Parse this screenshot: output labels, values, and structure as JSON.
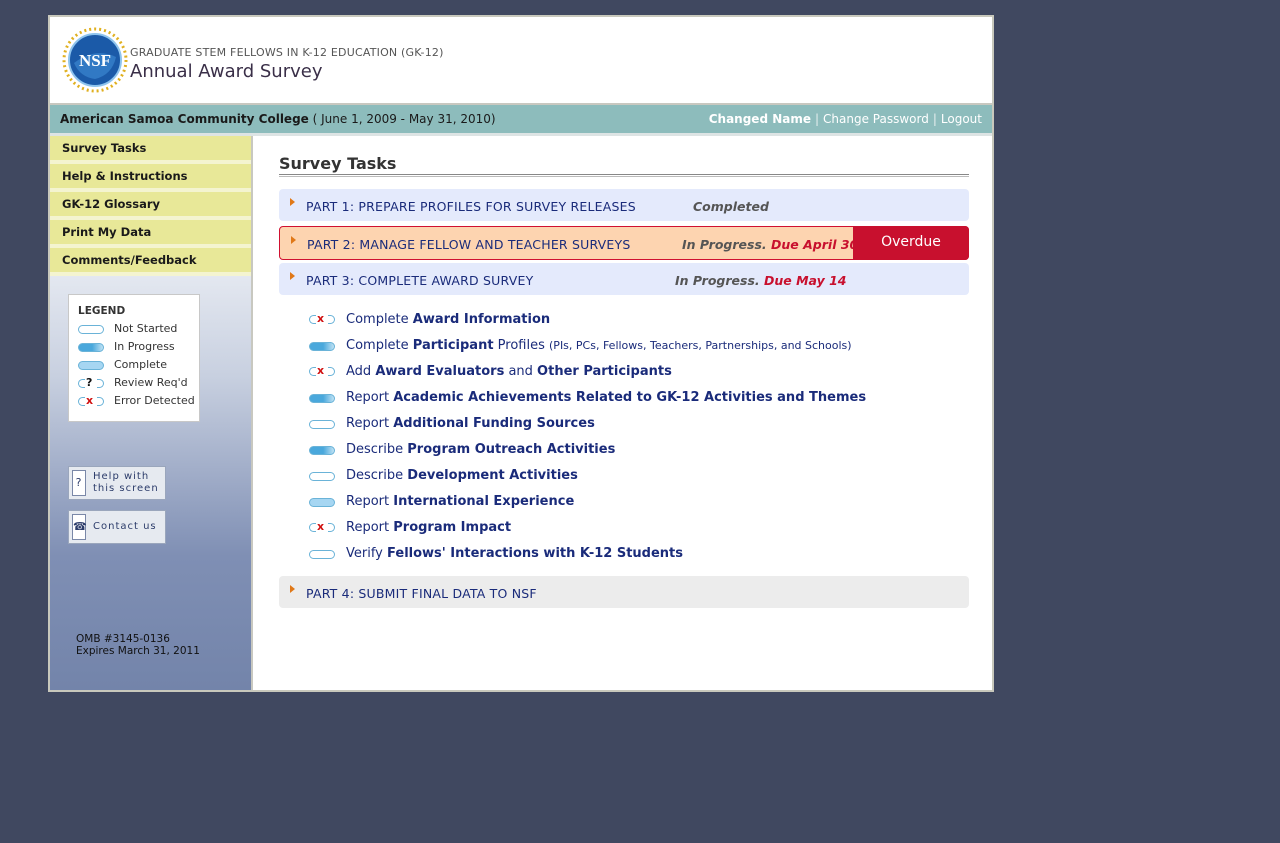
{
  "header": {
    "logo_text": "NSF",
    "program": "GRADUATE STEM FELLOWS IN K-12 EDUCATION (GK-12)",
    "title": "Annual Award Survey"
  },
  "infobar": {
    "organization": "American Samoa Community College",
    "period": "( June 1, 2009 - May 31, 2010)",
    "user": "Changed Name",
    "change_password": "Change Password",
    "logout": "Logout",
    "separator": "|"
  },
  "sidebar": {
    "items": [
      {
        "label": "Survey Tasks"
      },
      {
        "label": "Help & Instructions"
      },
      {
        "label": "GK-12 Glossary"
      },
      {
        "label": "Print My Data"
      },
      {
        "label": "Comments/Feedback"
      }
    ],
    "legend": {
      "title": "LEGEND",
      "items": [
        {
          "label": "Not Started"
        },
        {
          "label": "In Progress"
        },
        {
          "label": "Complete"
        },
        {
          "label": "Review Req'd",
          "mark": "?"
        },
        {
          "label": "Error Detected",
          "mark": "x"
        }
      ]
    },
    "help_button": {
      "line1": "Help with",
      "line2": "this screen",
      "icon": "?"
    },
    "contact_button": {
      "label": "Contact us"
    },
    "omb": {
      "number": "OMB #3145-0136",
      "expires": "Expires March 31, 2011"
    }
  },
  "main": {
    "title": "Survey Tasks",
    "parts": [
      {
        "label": "PART 1: PREPARE PROFILES FOR SURVEY RELEASES",
        "status": "Completed",
        "due": ""
      },
      {
        "label": "PART 2: MANAGE FELLOW AND TEACHER SURVEYS",
        "status": "In Progress.",
        "due": "Due April 30",
        "badge": "Overdue"
      },
      {
        "label": "PART 3: COMPLETE AWARD SURVEY",
        "status": "In Progress.",
        "due": "Due May 14"
      },
      {
        "label": "PART 4: SUBMIT FINAL DATA TO NSF"
      }
    ],
    "tasks": [
      {
        "status": "error",
        "verb": "Complete",
        "b1": "Award Information"
      },
      {
        "status": "in-progress",
        "verb": "Complete",
        "b1": "Participant",
        "rest": " Profiles ",
        "sub": "(PIs, PCs, Fellows, Teachers, Partnerships, and Schools)"
      },
      {
        "status": "error",
        "verb": "Add",
        "b1": "Award Evaluators",
        "mid": " and ",
        "b2": "Other Participants"
      },
      {
        "status": "in-progress",
        "verb": "Report",
        "b1": "Academic Achievements Related to GK-12 Activities and Themes"
      },
      {
        "status": "not-started",
        "verb": "Report",
        "b1": "Additional Funding Sources"
      },
      {
        "status": "in-progress",
        "verb": "Describe",
        "b1": "Program Outreach Activities"
      },
      {
        "status": "not-started",
        "verb": "Describe",
        "b1": "Development Activities"
      },
      {
        "status": "complete",
        "verb": "Report",
        "b1": "International Experience"
      },
      {
        "status": "error",
        "verb": "Report",
        "b1": "Program Impact"
      },
      {
        "status": "not-started",
        "verb": "Verify",
        "b1": "Fellows' Interactions with K-12 Students"
      }
    ]
  },
  "colors": {
    "background": "#404860",
    "infobar": "#8dbcbc",
    "nav_item": "#e8e898",
    "link": "#1a2b7a",
    "overdue": "#c8102e",
    "part_bg": "#e4eafc",
    "part2_bg": "#fdd4b0",
    "accent_arrow": "#e07818"
  }
}
